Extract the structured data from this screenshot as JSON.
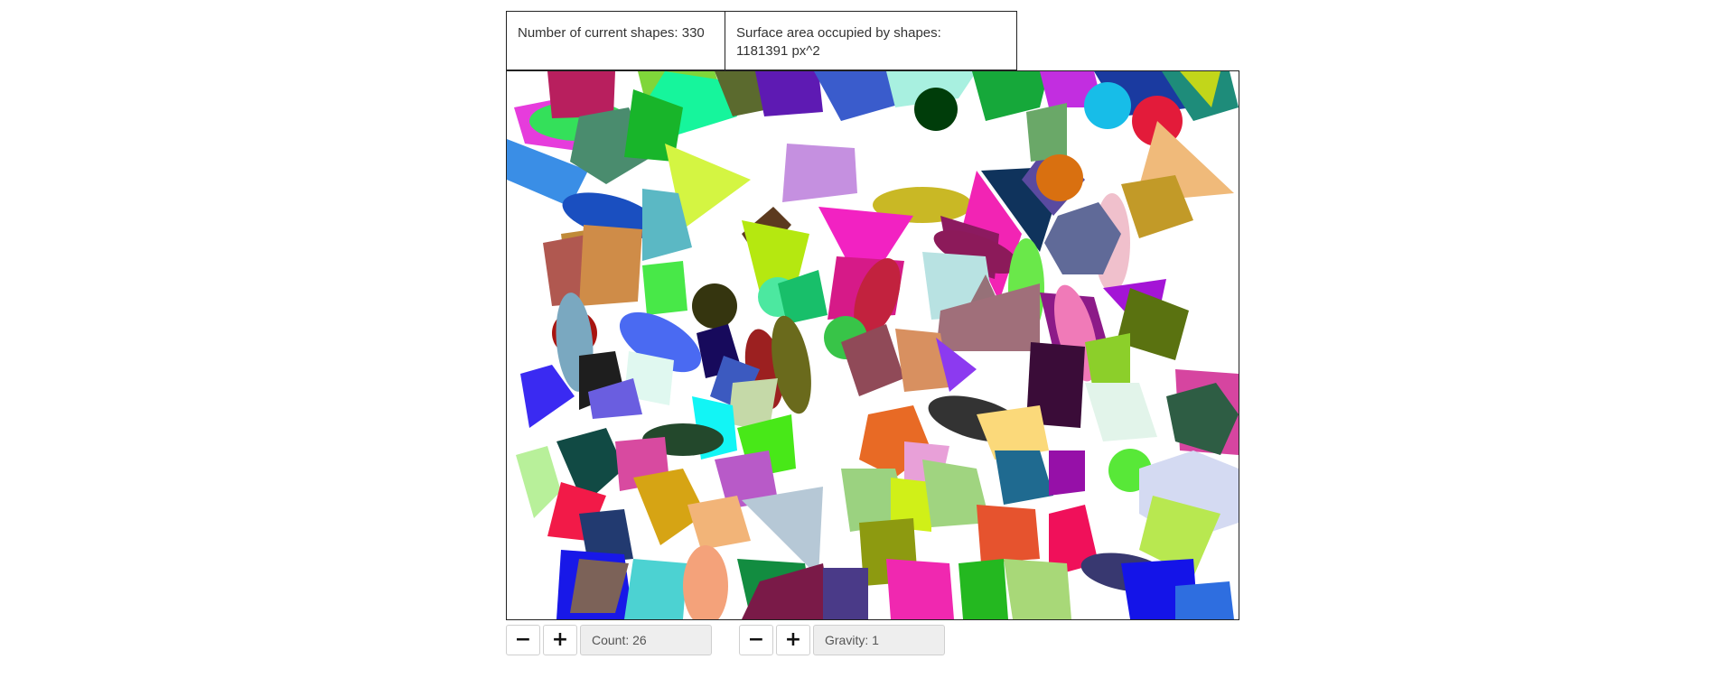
{
  "stats": {
    "shapes_label": "Number of current shapes: 330",
    "area_label": "Surface area occupied by shapes: 1181391 px^2"
  },
  "controls": {
    "count": {
      "minus_symbol": "−",
      "plus_symbol": "+",
      "value": "Count: 26"
    },
    "gravity": {
      "minus_symbol": "−",
      "plus_symbol": "+",
      "value": "Gravity: 1"
    }
  }
}
